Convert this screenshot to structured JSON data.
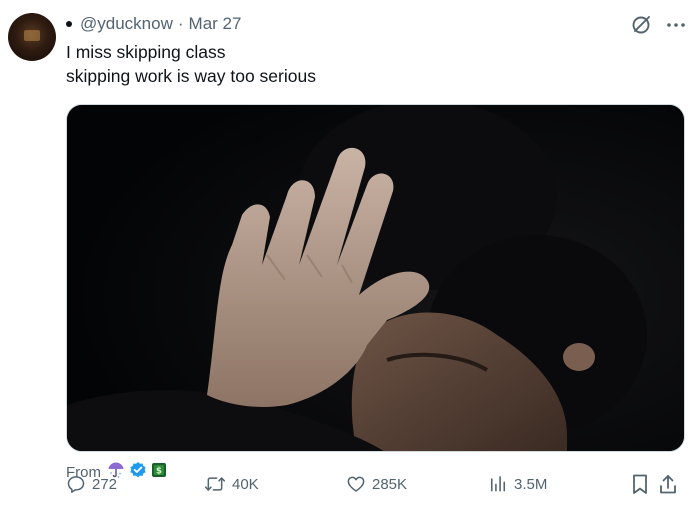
{
  "author": {
    "handle": "@yducknow",
    "date": "Mar 27"
  },
  "tweet": {
    "lines": [
      "I miss skipping class",
      "skipping work is way too serious"
    ]
  },
  "source": {
    "label": "From"
  },
  "actions": {
    "replies": "272",
    "reposts": "40K",
    "likes": "285K",
    "views": "3.5M"
  },
  "icons": {
    "grok": "grok-icon",
    "more": "more-icon",
    "reply": "reply-icon",
    "repost": "repost-icon",
    "like": "heart-icon",
    "views": "views-icon",
    "bookmark": "bookmark-icon",
    "share": "share-icon",
    "umbrella": "umbrella-emoji-icon",
    "verified": "verified-badge-icon",
    "money": "money-emoji-icon"
  },
  "colors": {
    "text": "#0f1419",
    "secondary": "#536471",
    "verified": "#1d9bf0",
    "border": "#cfd9de"
  }
}
